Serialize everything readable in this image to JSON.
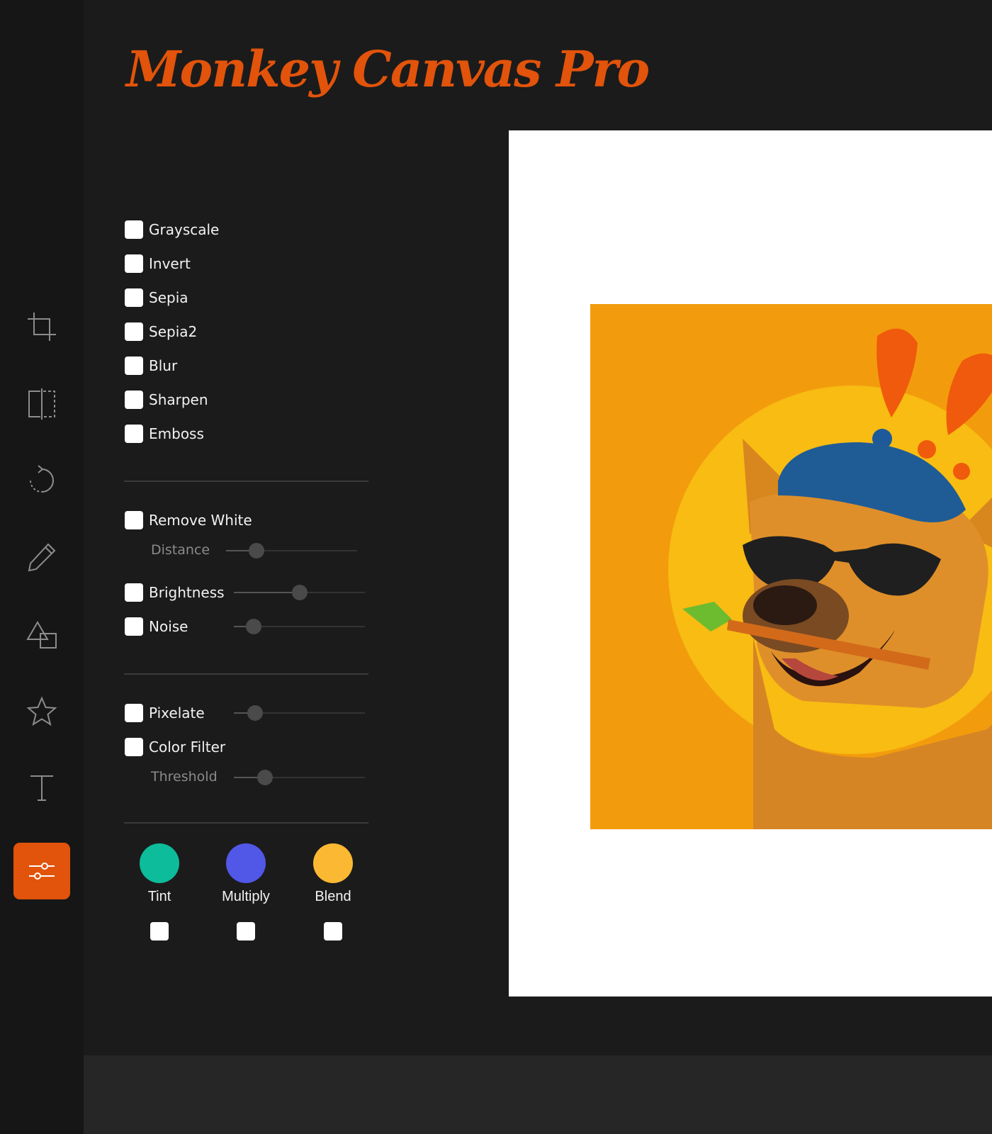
{
  "app": {
    "title": "Monkey Canvas Pro",
    "accent_color": "#e2530b"
  },
  "toolbar": {
    "tools": [
      {
        "name": "crop-icon",
        "active": false
      },
      {
        "name": "flip-icon",
        "active": false
      },
      {
        "name": "rotate-icon",
        "active": false
      },
      {
        "name": "pencil-icon",
        "active": false
      },
      {
        "name": "shapes-icon",
        "active": false
      },
      {
        "name": "star-icon",
        "active": false
      },
      {
        "name": "text-icon",
        "active": false
      },
      {
        "name": "sliders-icon",
        "active": true
      }
    ]
  },
  "filters": {
    "basic": [
      {
        "label": "Grayscale",
        "checked": false
      },
      {
        "label": "Invert",
        "checked": false
      },
      {
        "label": "Sepia",
        "checked": false
      },
      {
        "label": "Sepia2",
        "checked": false
      },
      {
        "label": "Blur",
        "checked": false
      },
      {
        "label": "Sharpen",
        "checked": false
      },
      {
        "label": "Emboss",
        "checked": false
      }
    ],
    "remove_white": {
      "label": "Remove White",
      "checked": false,
      "distance_label": "Distance",
      "distance_value": 0.23
    },
    "brightness": {
      "label": "Brightness",
      "checked": false,
      "value": 0.5
    },
    "noise": {
      "label": "Noise",
      "checked": false,
      "value": 0.15
    },
    "pixelate": {
      "label": "Pixelate",
      "checked": false,
      "value": 0.16
    },
    "color_filter": {
      "label": "Color Filter",
      "checked": false,
      "threshold_label": "Threshold",
      "threshold_value": 0.24
    },
    "blend_modes": [
      {
        "label": "Tint",
        "color": "#0dbc9a",
        "checked": false
      },
      {
        "label": "Multiply",
        "color": "#5157e6",
        "checked": false
      },
      {
        "label": "Blend",
        "color": "#fbb833",
        "checked": false
      }
    ]
  },
  "canvas": {
    "background": "#ffffff",
    "artwork_background": "#f29c0d"
  }
}
